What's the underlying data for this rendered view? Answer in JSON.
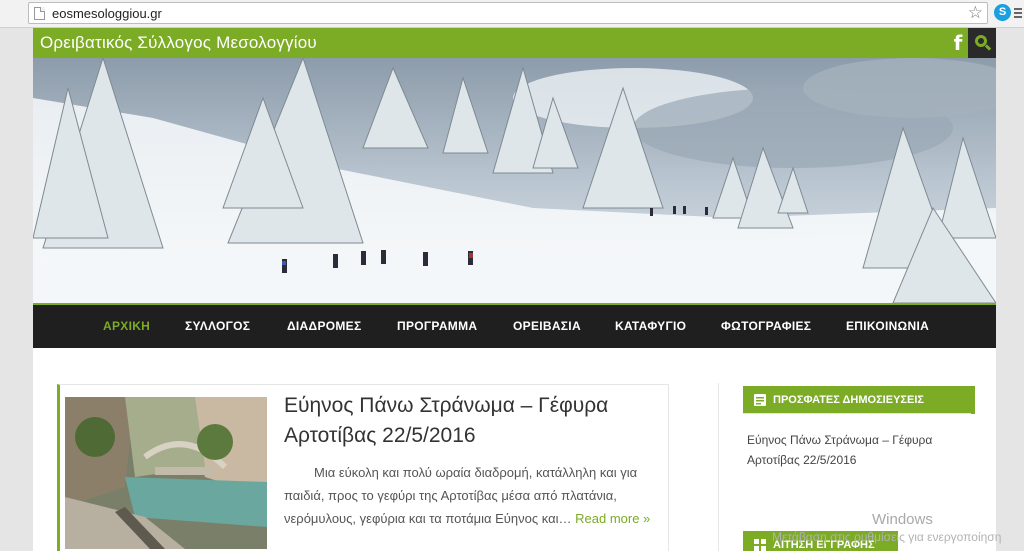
{
  "browser": {
    "url": "eosmesologgiou.gr"
  },
  "header": {
    "site_title": "Ορειβατικός Σύλλογος Μεσολογγίου",
    "facebook_glyph": "f"
  },
  "nav": {
    "items": [
      {
        "label": "ΑΡΧΙΚΗ",
        "active": true
      },
      {
        "label": "ΣΥΛΛΟΓΟΣ",
        "active": false
      },
      {
        "label": "ΔΙΑΔΡΟΜΕΣ",
        "active": false
      },
      {
        "label": "ΠΡΟΓΡΑΜΜΑ",
        "active": false
      },
      {
        "label": "ΟΡΕΙΒΑΣΙΑ",
        "active": false
      },
      {
        "label": "ΚΑΤΑΦΥΓΙΟ",
        "active": false
      },
      {
        "label": "ΦΩΤΟΓΡΑΦΙΕΣ",
        "active": false
      },
      {
        "label": "ΕΠΙΚΟΙΝΩΝΙΑ",
        "active": false
      }
    ]
  },
  "post": {
    "title": "Εύηνος Πάνω Στράνωμα – Γέφυρα Αρτοτίβας 22/5/2016",
    "excerpt": "Μια εύκολη και πολύ ωραία διαδρομή, κατάλληλη και για παιδιά, προς το  γεφύρι της Αρτοτίβας μέσα  από πλατάνια, νερόμυλους, γεφύρια και τα ποτάμια Εύηνος και…",
    "read_more": "Read more »"
  },
  "sidebar": {
    "recent_posts_title": "ΠΡΟΣΦΑΤΕΣ ΔΗΜΟΣΙΕΥΣΕΙΣ",
    "recent_posts": [
      "Εύηνος Πάνω Στράνωμα – Γέφυρα Αρτοτίβας 22/5/2016"
    ],
    "registration_title": "ΑΙΤΗΣΗ ΕΓΓΡΑΦΗΣ"
  },
  "watermark": {
    "line1": "Windows",
    "line2": "Μετάβαση στις ρυθμίσεις για ενεργοποίηση"
  },
  "colors": {
    "accent": "#7cab25",
    "nav_bg": "#1f1f1f"
  }
}
